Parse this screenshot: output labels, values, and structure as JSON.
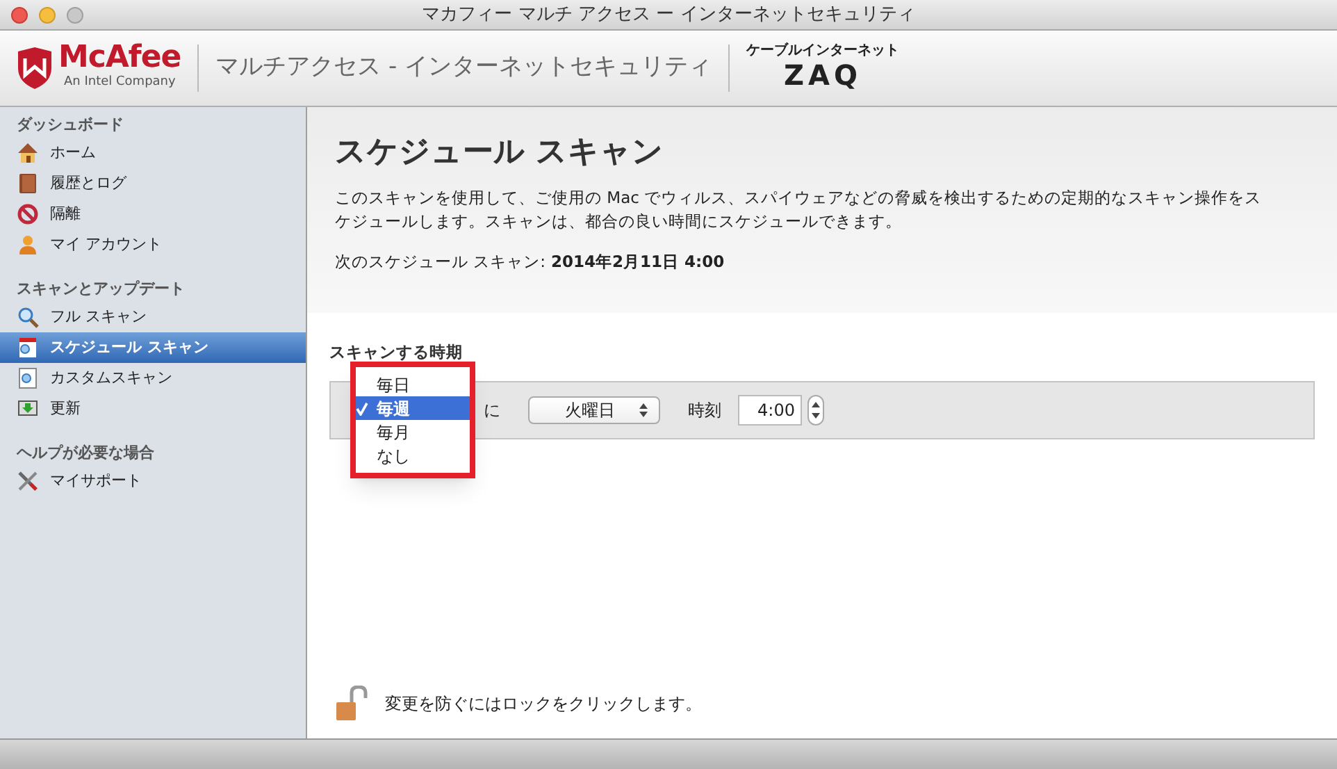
{
  "window": {
    "title": "マカフィー マルチ アクセス ー インターネットセキュリティ"
  },
  "header": {
    "brand": "McAfee",
    "brand_sub": "An Intel Company",
    "product": "マルチアクセス - インターネットセキュリティ",
    "partner_caption": "ケーブルインターネット",
    "partner": "ZAQ"
  },
  "sidebar": {
    "sections": [
      {
        "title": "ダッシュボード",
        "items": [
          {
            "label": "ホーム",
            "kind": "home",
            "selected": false
          },
          {
            "label": "履歴とログ",
            "kind": "book",
            "selected": false
          },
          {
            "label": "隔離",
            "kind": "ban",
            "selected": false
          },
          {
            "label": "マイ アカウント",
            "kind": "user",
            "selected": false
          }
        ]
      },
      {
        "title": "スキャンとアップデート",
        "items": [
          {
            "label": "フル スキャン",
            "kind": "search",
            "selected": false
          },
          {
            "label": "スケジュール スキャン",
            "kind": "calendar",
            "selected": true
          },
          {
            "label": "カスタムスキャン",
            "kind": "doc",
            "selected": false
          },
          {
            "label": "更新",
            "kind": "download",
            "selected": false
          }
        ]
      },
      {
        "title": "ヘルプが必要な場合",
        "items": [
          {
            "label": "マイサポート",
            "kind": "tools",
            "selected": false
          }
        ]
      }
    ]
  },
  "main": {
    "title": "スケジュール スキャン",
    "description": "このスキャンを使用して、ご使用の Mac でウィルス、スパイウェアなどの脅威を検出するための定期的なスキャン操作をスケジュールします。スキャンは、都合の良い時間にスケジュールできます。",
    "next_scan_label": "次のスケジュール スキャン:",
    "next_scan_value": "2014年2月11日 4:00"
  },
  "schedule": {
    "label": "スキャンする時期",
    "frequency_menu": [
      {
        "label": "毎日",
        "selected": false
      },
      {
        "label": "毎週",
        "selected": true
      },
      {
        "label": "毎月",
        "selected": false
      },
      {
        "label": "なし",
        "selected": false
      }
    ],
    "on_label": "に",
    "day": "火曜日",
    "time_label": "時刻",
    "time": "4:00"
  },
  "lock_hint": "変更を防ぐにはロックをクリックします。"
}
